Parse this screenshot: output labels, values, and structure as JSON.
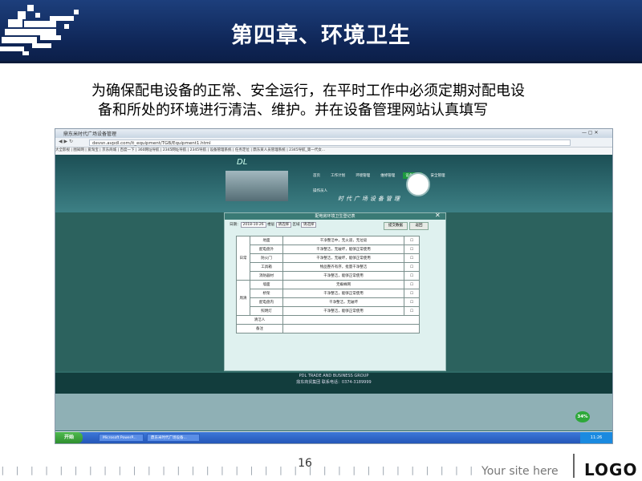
{
  "slide": {
    "title": "第四章、环境卫生",
    "body_line1": "为确保配电设备的正常、安全运行，在平时工作中必须定期对配电设",
    "body_line2": "备和所处的环境进行清洁、维护。并在设备管理网站认真填写",
    "page_number": "16",
    "site_text": "Your site here",
    "logo_text": "LOGO",
    "ticks": "| | | | | | | | | | | | | | | | | | | | | | | | | | | | | | | | | | | | | | | | | | | | | | | | | | | | | | | | | |"
  },
  "browser": {
    "tab_title": "鼎东米时代广场设备管理",
    "address": "devsn.avpdl.com/it_equipment/TGB/Equipment1.html",
    "bookmarks": "大全影视 | 图知网 | 爱淘宝 | 京东商城 | 百度一下 | 360网址导航 | 2345网址导航 | 2345导航 | 设备管理系统 | 任务定位 | 鼎东某人员管理系统 | 2345导航_第一代女..."
  },
  "webpage": {
    "nav": [
      "首页",
      "工作计划",
      "环境管理",
      "维修管理",
      "设备管理",
      "安全管理",
      "操作员人"
    ],
    "nav_active_index": 4,
    "system_title": "时代广场设备管理",
    "panel_title": "配电房环境卫生登记表",
    "filter": {
      "date_label": "日期：",
      "date_value": "2018-10-26",
      "building_label": "楼层",
      "building_value": "请选择",
      "area_label": "区域",
      "area_value": "请选择"
    },
    "query_button": "提交数据",
    "return_button": "返回",
    "groups": [
      {
        "label": "日常",
        "rows": [
          {
            "item": "地面",
            "standard": "干净整洁中，无火道，无垃圾"
          },
          {
            "item": "配电盘外",
            "standard": "干净整洁，无破坏，能够正常使用"
          },
          {
            "item": "防火门",
            "standard": "干净整洁，无破坏，能够正常使用"
          },
          {
            "item": "工具箱",
            "standard": "物品整齐有序，批量干净整洁"
          },
          {
            "item": "消防器材",
            "standard": "干净整洁，能够正常使用"
          }
        ]
      },
      {
        "label": "周清",
        "rows": [
          {
            "item": "墙面",
            "standard": "无蜘蛛网"
          },
          {
            "item": "桥架",
            "standard": "干净整洁，能够正常使用"
          },
          {
            "item": "配电盘内",
            "standard": "干净整洁，无破坏"
          },
          {
            "item": "照明灯",
            "standard": "干净整洁，能够正常使用"
          }
        ]
      }
    ],
    "cleaner_label": "清洁人",
    "remark_label": "备注",
    "footer_en": "PDL TRADE AND BUSINESS GROUP",
    "footer_cn": "鼎东商贸集团    联系电话：0374-3189999"
  },
  "taskbar": {
    "start_label": "开始",
    "tasks": [
      "Microsoft PowerP...",
      "鼎东米时代广场设备..."
    ],
    "tray_badge": "34%",
    "clock": "11:26"
  }
}
